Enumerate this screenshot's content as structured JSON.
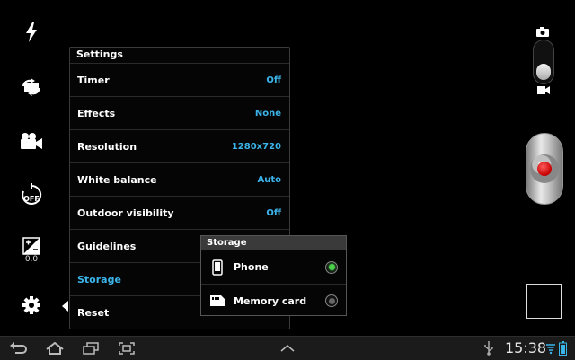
{
  "settings": {
    "title": "Settings",
    "rows": [
      {
        "label": "Timer",
        "value": "Off"
      },
      {
        "label": "Effects",
        "value": "None"
      },
      {
        "label": "Resolution",
        "value": "1280x720"
      },
      {
        "label": "White balance",
        "value": "Auto"
      },
      {
        "label": "Outdoor visibility",
        "value": "Off"
      },
      {
        "label": "Guidelines",
        "value": ""
      },
      {
        "label": "Storage",
        "value": ""
      },
      {
        "label": "Reset",
        "value": ""
      }
    ],
    "selected": "Storage"
  },
  "storage_popup": {
    "title": "Storage",
    "options": [
      {
        "label": "Phone",
        "selected": true,
        "icon": "phone-icon"
      },
      {
        "label": "Memory card",
        "selected": false,
        "icon": "memory-card-icon"
      }
    ]
  },
  "left_rail": {
    "icons": [
      "flash-icon",
      "switch-camera-icon",
      "recording-mode-icon",
      "timer-off-icon",
      "exposure-icon",
      "settings-gear-icon"
    ],
    "exposure_value": "0.0"
  },
  "right_rail": {
    "mode_icons": [
      "camera-icon",
      "video-icon"
    ],
    "current_mode": "video"
  },
  "status_bar": {
    "time": "15:38",
    "icons": [
      "back-icon",
      "home-icon",
      "recent-apps-icon",
      "screenshot-icon",
      "up-chevron-icon",
      "usb-icon",
      "wifi-icon",
      "battery-icon"
    ]
  },
  "colors": {
    "accent": "#3bb4ea",
    "radio_on": "#4bd14b",
    "record": "#d00000"
  }
}
